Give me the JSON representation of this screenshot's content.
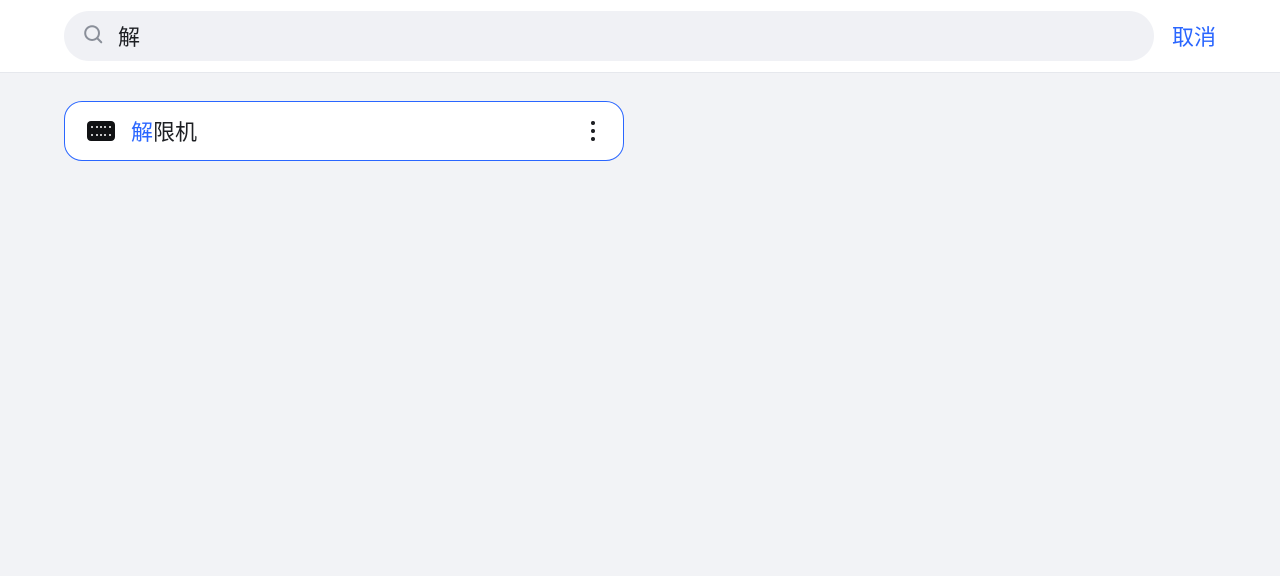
{
  "header": {
    "search_value": "解",
    "cancel_label": "取消"
  },
  "results": [
    {
      "icon": "keyboard-icon",
      "highlight": "解",
      "rest": "限机"
    }
  ]
}
